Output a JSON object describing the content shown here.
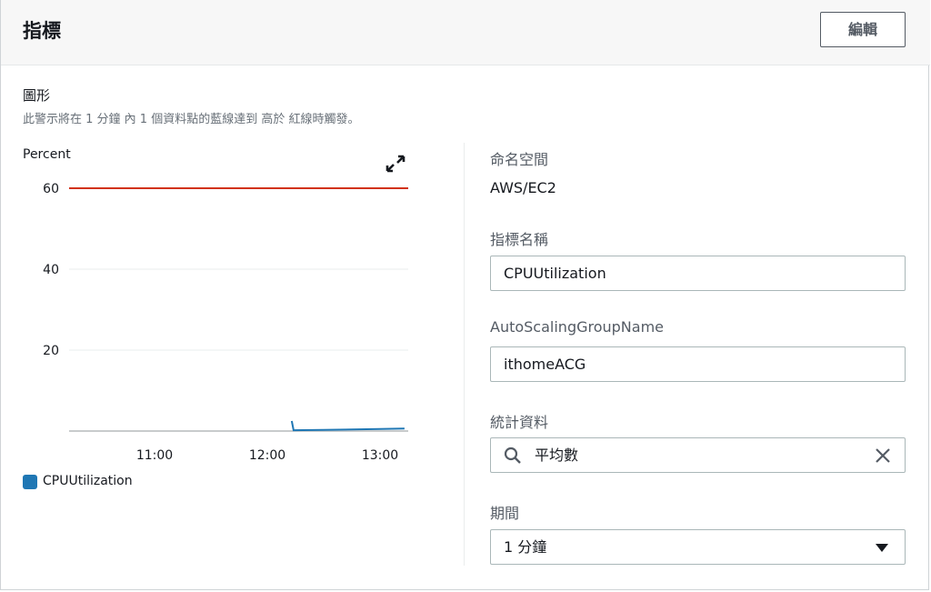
{
  "header": {
    "title": "指標",
    "edit_label": "編輯"
  },
  "graph": {
    "label": "圖形",
    "description": "此警示將在 1 分鐘 內 1 個資料點的藍線達到 高於 紅線時觸發。",
    "y_unit": "Percent",
    "expand_icon": "expand-arrows-icon"
  },
  "chart_data": {
    "type": "line",
    "ylabel": "Percent",
    "xlabel": "",
    "ylim": [
      0,
      65
    ],
    "y_ticks": [
      "60",
      "40",
      "20"
    ],
    "x_ticks": [
      "11:00",
      "12:00",
      "13:00"
    ],
    "series": [
      {
        "name": "CPUUtilization",
        "color": "#1f77b4",
        "x": [
          "12:13",
          "12:14",
          "12:30",
          "13:00",
          "13:13"
        ],
        "y": [
          2.5,
          0.2,
          0.3,
          0.5,
          0.6
        ]
      }
    ],
    "threshold": {
      "value": 60,
      "color": "#d13212"
    },
    "legend": [
      {
        "label": "CPUUtilization",
        "color": "#1f77b4"
      }
    ],
    "legend_position": "bottom-left",
    "grid": true
  },
  "fields": {
    "namespace_label": "命名空間",
    "namespace_value": "AWS/EC2",
    "metric_name_label": "指標名稱",
    "metric_name_value": "CPUUtilization",
    "asg_label": "AutoScalingGroupName",
    "asg_value": "ithomeACG",
    "statistic_label": "統計資料",
    "statistic_value": "平均數",
    "period_label": "期間",
    "period_value": "1 分鐘"
  },
  "colors": {
    "threshold": "#d13212",
    "series": "#1f77b4",
    "baseline": "#c8cbcc"
  }
}
